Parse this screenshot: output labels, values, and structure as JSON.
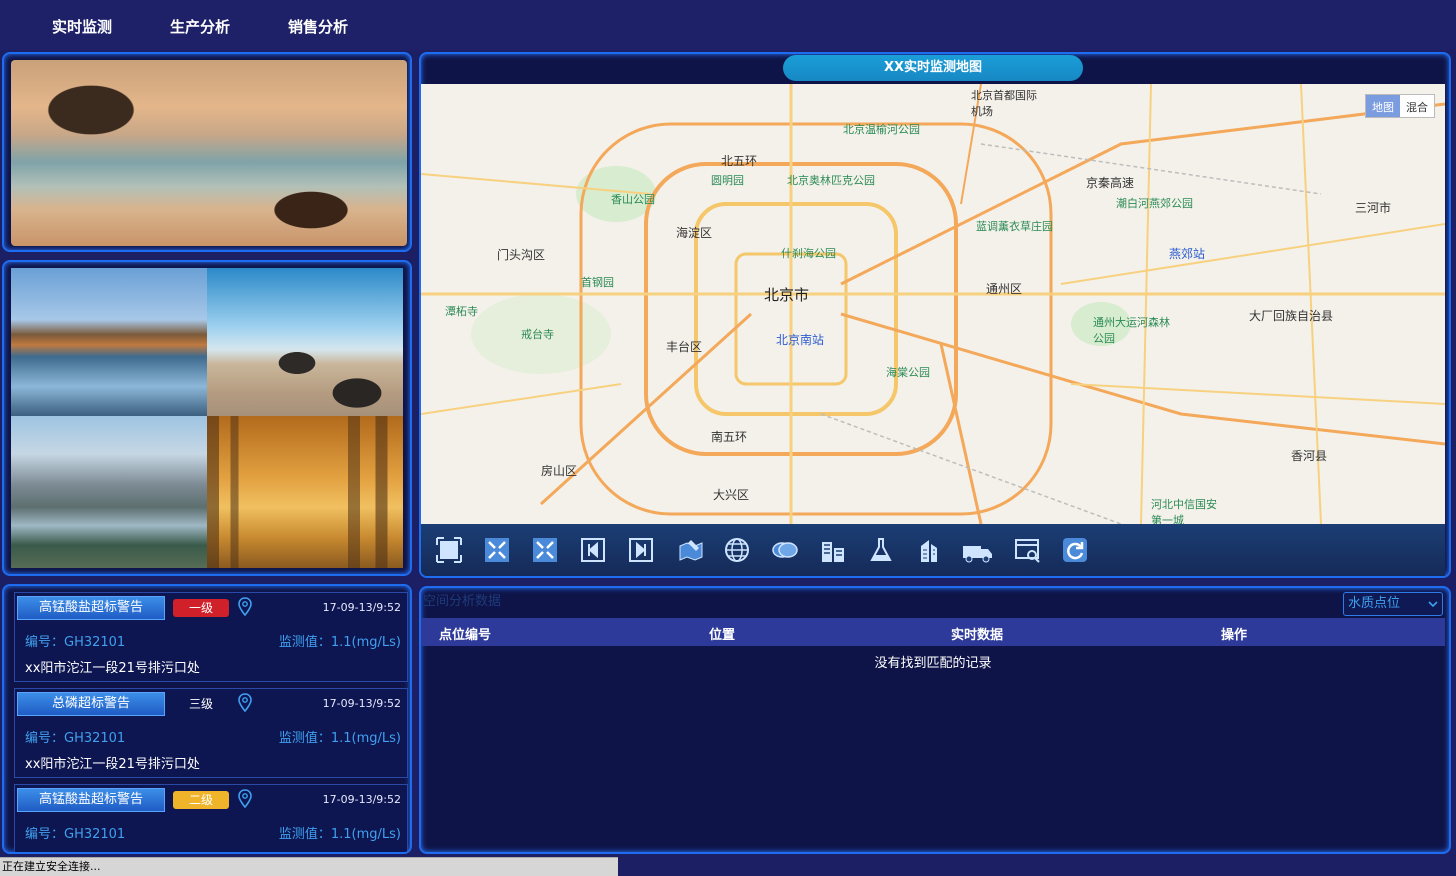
{
  "nav": {
    "items": [
      "实时监测",
      "生产分析",
      "销售分析"
    ]
  },
  "alerts": [
    {
      "title": "高锰酸盐超标警告",
      "level": "一级",
      "level_color": "#d0202a",
      "time": "17-09-13/9:52",
      "code": "编号：GH32101",
      "value": "监测值：1.1(mg/Ls)",
      "location": "xx阳市沱江一段21号排污口处"
    },
    {
      "title": "总磷超标警告",
      "level": "三级",
      "level_color": "",
      "time": "17-09-13/9:52",
      "code": "编号：GH32101",
      "value": "监测值：1.1(mg/Ls)",
      "location": "xx阳市沱江一段21号排污口处"
    },
    {
      "title": "高锰酸盐超标警告",
      "level": "二级",
      "level_color": "#f0b42a",
      "time": "17-09-13/9:52",
      "code": "编号：GH32101",
      "value": "监测值：1.1(mg/Ls)",
      "location": ""
    }
  ],
  "map": {
    "title": "XX实时监测地图",
    "type_options": [
      "地图",
      "混合"
    ],
    "labels": {
      "beijing": "北京市",
      "haidian": "海淀区",
      "fengtai": "丰台区",
      "tongzhou": "通州区",
      "mentougou": "门头沟区",
      "daxing": "大兴区",
      "fangshan": "房山区",
      "sanhe": "三河市",
      "dachang": "大厂回族自治县",
      "xianghe": "香河县",
      "beiwuhuan": "北五环",
      "nanwuhuan": "南五环",
      "yiheyuan": "圆明园",
      "xiangshan": "香山公园",
      "shichahai": "什刹海公园",
      "capital_airport": "北京首都国际机场",
      "beijing_south": "北京南站",
      "yanjiao": "燕郊站",
      "jingqin": "京秦高速",
      "haitang": "海棠公园",
      "tongzhou_canal": "通州大运河森林公园",
      "shougang": "首钢园",
      "tanzhe": "潭柘寺",
      "jietai": "戒台寺",
      "wenyuhe": "北京温榆河公园",
      "lanlin": "蓝调薰衣草庄园",
      "chaobai": "潮白河燕郊公园",
      "hebei_zhongxin": "河北中信国安第一城",
      "olympic": "北京奥林匹克公园"
    }
  },
  "toolbar_icons": [
    "fullscreen-icon",
    "expand-icon",
    "collapse-icon",
    "prev-icon",
    "next-icon",
    "map-edit-icon",
    "globe-icon",
    "coins-icon",
    "buildings-icon",
    "flask-icon",
    "tower-icon",
    "truck-icon",
    "browser-icon",
    "refresh-icon"
  ],
  "table": {
    "caption": "空间分析数据",
    "select_value": "水质点位",
    "headers": [
      "点位编号",
      "位置",
      "实时数据",
      "操作"
    ],
    "empty_text": "没有找到匹配的记录"
  },
  "status_text": "正在建立安全连接..."
}
